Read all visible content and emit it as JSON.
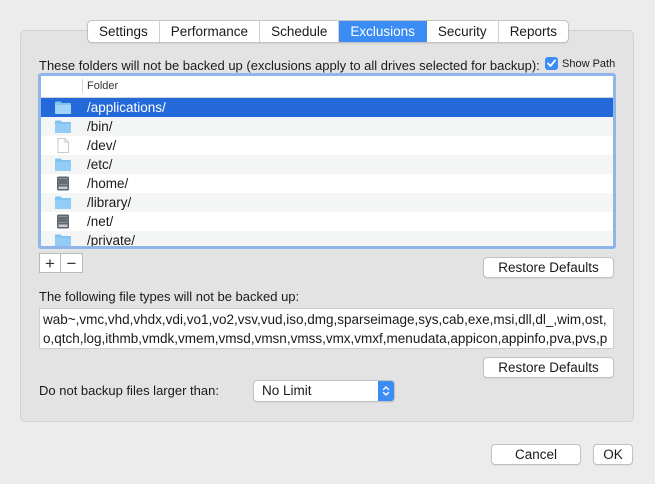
{
  "tabs": [
    "Settings",
    "Performance",
    "Schedule",
    "Exclusions",
    "Security",
    "Reports"
  ],
  "active_tab": "Exclusions",
  "exclusions": {
    "heading": "These folders will not be backed up (exclusions apply to all drives selected for backup):",
    "show_path_label": "Show Path",
    "show_path_checked": true,
    "column_header": "Folder",
    "folders": [
      {
        "name": "/applications/",
        "icon": "folder-icon",
        "selected": true
      },
      {
        "name": "/bin/",
        "icon": "folder-icon",
        "selected": false
      },
      {
        "name": "/dev/",
        "icon": "document-icon",
        "selected": false
      },
      {
        "name": "/etc/",
        "icon": "folder-icon",
        "selected": false
      },
      {
        "name": "/home/",
        "icon": "drive-icon",
        "selected": false
      },
      {
        "name": "/library/",
        "icon": "folder-icon",
        "selected": false
      },
      {
        "name": "/net/",
        "icon": "drive-icon",
        "selected": false
      },
      {
        "name": "/private/",
        "icon": "folder-icon",
        "selected": false
      }
    ],
    "add_label": "+",
    "remove_label": "−",
    "restore_defaults_label": "Restore Defaults"
  },
  "file_types": {
    "label": "The following file types will not be backed up:",
    "value": "wab~,vmc,vhd,vhdx,vdi,vo1,vo2,vsv,vud,iso,dmg,sparseimage,sys,cab,exe,msi,dll,dl_,wim,ost,o,qtch,log,ithmb,vmdk,vmem,vmsd,vmsn,vmss,vmx,vmxf,menudata,appicon,appinfo,pva,pvs,pv",
    "restore_defaults_label": "Restore Defaults"
  },
  "size_limit": {
    "label": "Do not backup files larger than:",
    "value": "No Limit"
  },
  "footer": {
    "cancel_label": "Cancel",
    "ok_label": "OK"
  },
  "colors": {
    "accent": "#3b8cf5",
    "selection": "#2369d9",
    "folder": "#7fc3f2"
  }
}
